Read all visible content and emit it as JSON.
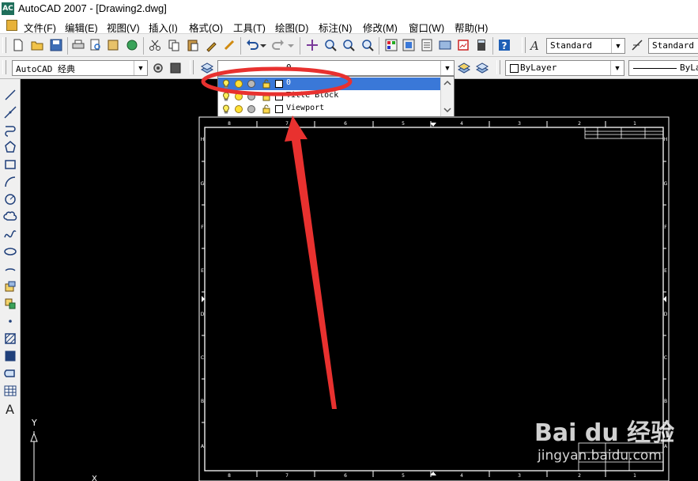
{
  "window": {
    "title": "AutoCAD 2007 - [Drawing2.dwg]",
    "logo_text": "AC"
  },
  "menu": [
    "文件(F)",
    "编辑(E)",
    "视图(V)",
    "插入(I)",
    "格式(O)",
    "工具(T)",
    "绘图(D)",
    "标注(N)",
    "修改(M)",
    "窗口(W)",
    "帮助(H)"
  ],
  "toolbar": {
    "text_style": "Standard",
    "dim_style": "Standard",
    "workspace": "AutoCAD 经典",
    "current_layer": "0",
    "color": "ByLayer",
    "linetype": "ByLa"
  },
  "layer_dropdown": {
    "items": [
      {
        "name": "0",
        "selected": true
      },
      {
        "name": "Title Block",
        "selected": false
      },
      {
        "name": "Viewport",
        "selected": false
      }
    ]
  },
  "drawing": {
    "zone_numbers_top": [
      "8",
      "7",
      "6",
      "5",
      "4",
      "3",
      "2",
      "1"
    ],
    "zone_numbers_bottom": [
      "8",
      "7",
      "6",
      "5",
      "4",
      "3",
      "2",
      "1"
    ],
    "zone_letters": [
      "H",
      "G",
      "F",
      "E",
      "D",
      "C",
      "B",
      "A"
    ]
  },
  "ucs": {
    "y_label": "Y",
    "x_label": "X"
  },
  "annotation": {
    "highlight_color": "#e8312f"
  },
  "watermark": {
    "brand": "Bai du 经验",
    "url": "jingyan.baidu.com"
  }
}
